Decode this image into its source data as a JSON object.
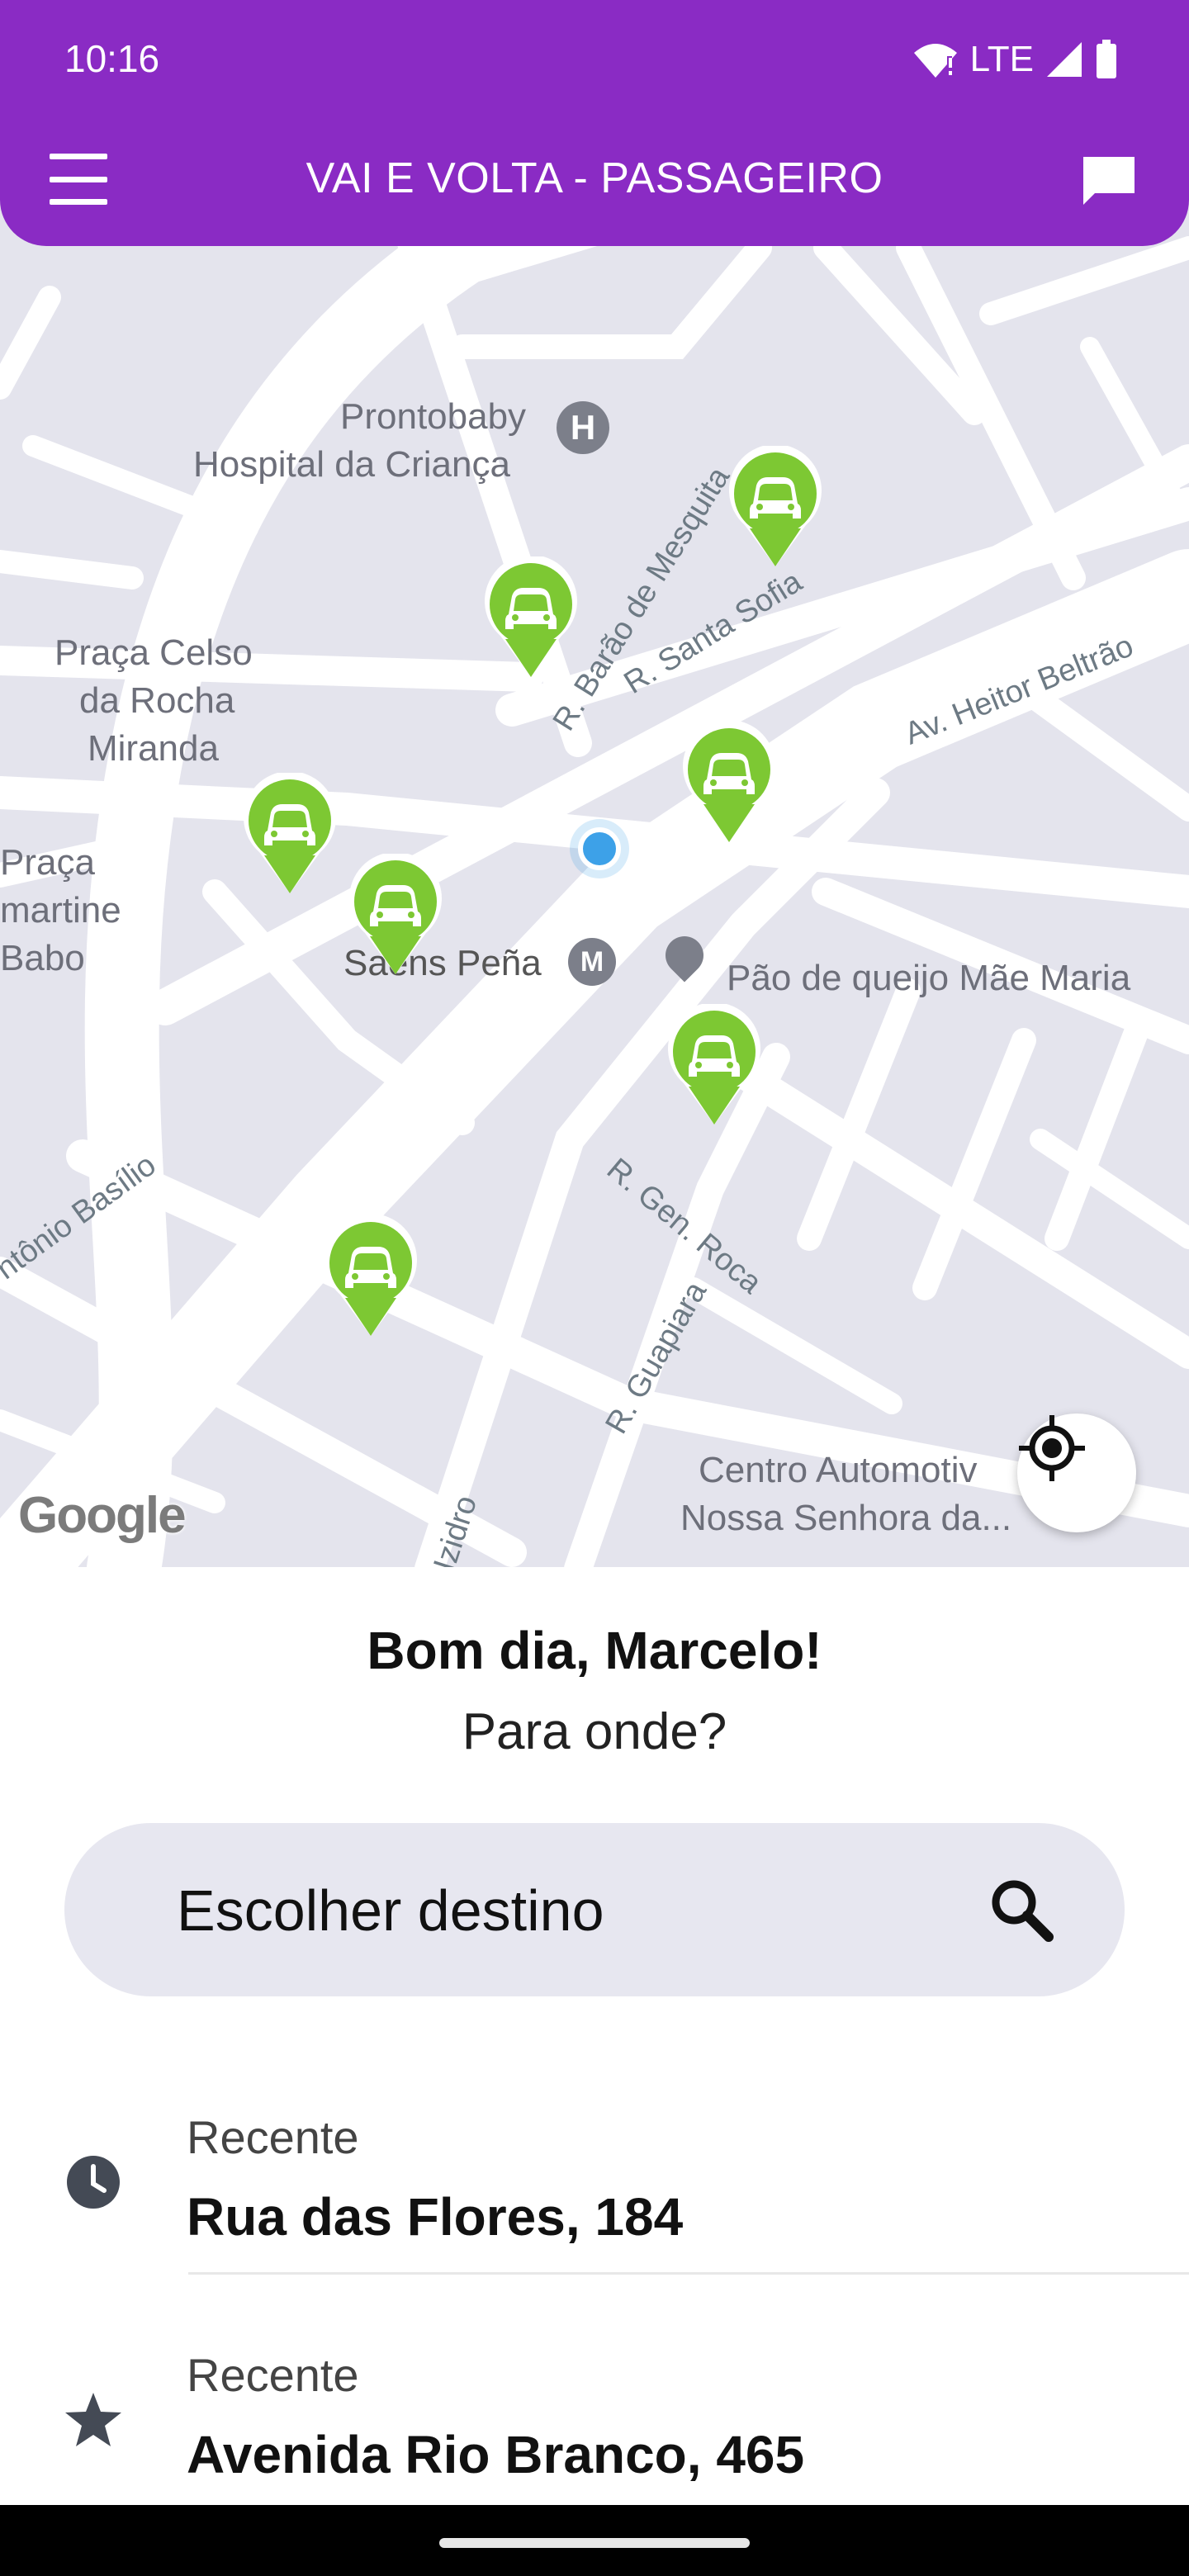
{
  "status_bar": {
    "time": "10:16",
    "network": "LTE"
  },
  "header": {
    "title": "VAI E VOLTA - PASSAGEIRO"
  },
  "map": {
    "places": [
      {
        "text": "Prontobaby"
      },
      {
        "text": "Hospital da Criança"
      },
      {
        "text": "Praça Celso"
      },
      {
        "text": "da Rocha"
      },
      {
        "text": "Miranda"
      },
      {
        "text": "Praça"
      },
      {
        "text": "martine"
      },
      {
        "text": "Babo"
      },
      {
        "text": "Saens Peña"
      },
      {
        "text": "Pão de queijo Mãe Maria"
      },
      {
        "text": "Centro Automotiv"
      },
      {
        "text": "Nossa Senhora da..."
      }
    ],
    "streets": [
      {
        "text": "R. Barão de Mesquita"
      },
      {
        "text": "R. Santa Sofia"
      },
      {
        "text": "Av. Heitor Beltrão"
      },
      {
        "text": "ntônio Basílio"
      },
      {
        "text": "R. Gen. Roca"
      },
      {
        "text": "R. Guapiara"
      },
      {
        "text": "Izidro"
      }
    ],
    "attribution": "Google",
    "car_count": 7
  },
  "panel": {
    "greeting": "Bom dia, Marcelo!",
    "question": "Para onde?",
    "search_label": "Escolher destino",
    "recents": [
      {
        "icon": "clock-icon",
        "label": "Recente",
        "address": "Rua das Flores, 184"
      },
      {
        "icon": "star-icon",
        "label": "Recente",
        "address": "Avenida Rio Branco, 465"
      }
    ]
  },
  "colors": {
    "brand": "#8a2bc4",
    "car_pin": "#7dc833",
    "map_bg": "#e4e4ed",
    "user_location": "#3da1e8"
  }
}
